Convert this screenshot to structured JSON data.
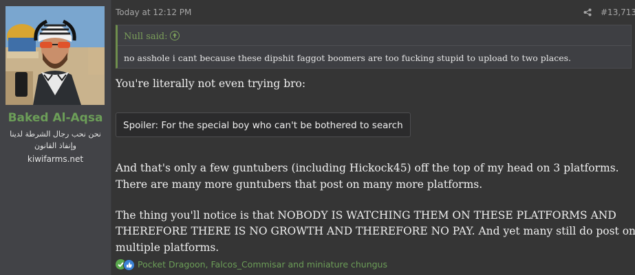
{
  "user": {
    "name": "Baked Al-Aqsa",
    "title": "نحن نحب رجال الشرطة لدينا وإنفاذ القانون",
    "site": "kiwifarms.net"
  },
  "post": {
    "timestamp": "Today at 12:12 PM",
    "number": "#13,713",
    "quote": {
      "author": "Null said:",
      "text": "no asshole i cant because these dipshit faggot boomers are too fucking stupid to upload to two places."
    },
    "lines": [
      "You're literally not even trying bro:",
      "And that's only a few guntubers (including Hickock45) off the top of my head on 3 platforms.",
      "There are many more guntubers that post on many more platforms.",
      "The thing you'll notice is that NOBODY IS WATCHING THEM ON THESE PLATFORMS AND",
      "THEREFORE THERE IS NO GROWTH AND THEREFORE NO PAY. And yet many still do post on",
      "multiple platforms."
    ],
    "spoiler_label": "Spoiler: For the special boy who can't be bothered to search",
    "reactions": "Pocket Dragoon, Falcos_Commisar and miniature chungus"
  },
  "colors": {
    "username": "#6c9e58",
    "quote_accent": "#7b9f5a",
    "background": "#353535",
    "sidebar": "#424347"
  },
  "icons": {
    "share": "share-icon",
    "quote_jump": "arrow-up-circle-icon",
    "reaction_like": "thumbs-up-icon",
    "reaction_agree": "checkmark-icon"
  }
}
